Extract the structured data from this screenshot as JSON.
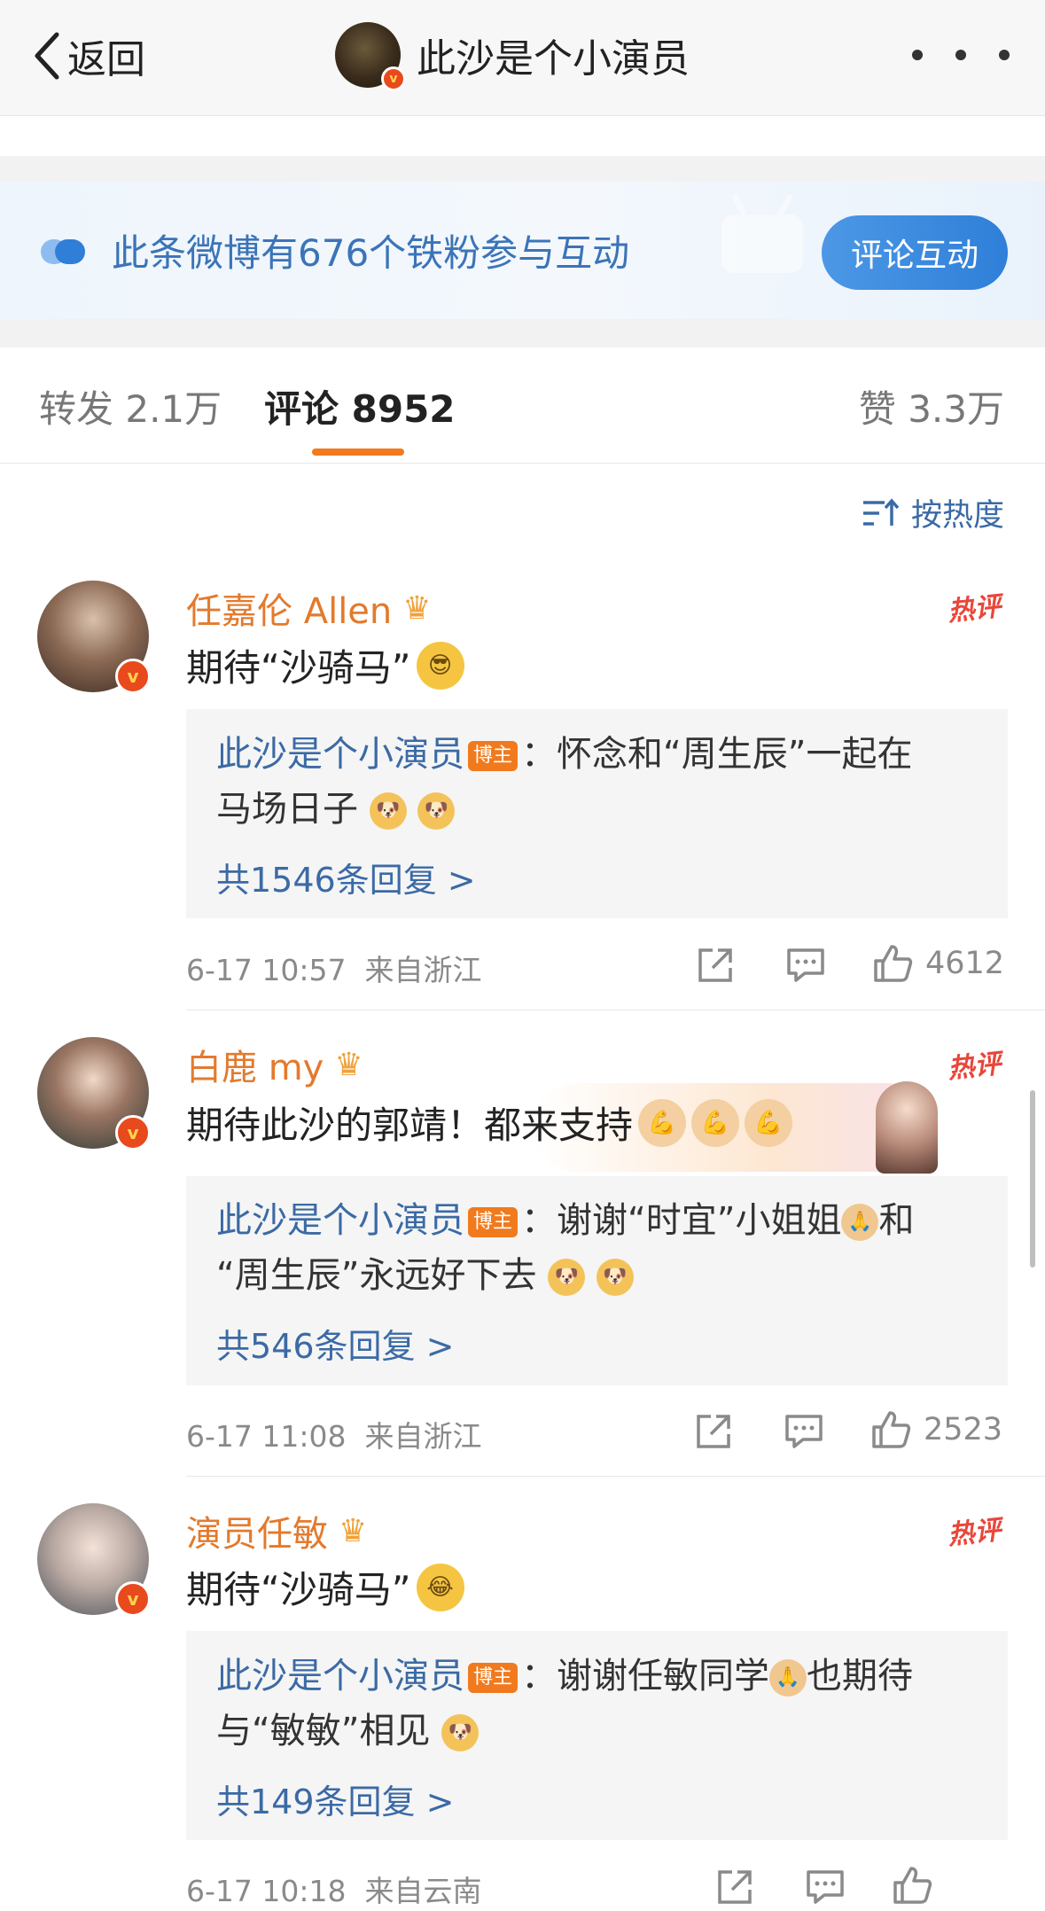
{
  "nav": {
    "back_label": "返回",
    "title": "此沙是个小演员",
    "more_label": "more"
  },
  "banner": {
    "text": "此条微博有676个铁粉参与互动",
    "button": "评论互动"
  },
  "tabs": {
    "repost": "转发 2.1万",
    "comment": "评论 8952",
    "like": "赞 3.3万"
  },
  "sort_label": "按热度",
  "comments": [
    {
      "name": "任嘉伦 Allen",
      "hot_label": "热评",
      "text": "期待“沙骑马”",
      "reply_user": "此沙是个小演员",
      "reply_tag": "博主",
      "reply_line1": "：怀念和“周生辰”一起在",
      "reply_line2": "马场日子",
      "reply_count": "共1546条回复 >",
      "time": "6-17 10:57",
      "location": "来自浙江",
      "likes": "4612"
    },
    {
      "name": "白鹿 my",
      "hot_label": "热评",
      "text": "期待此沙的郭靖！都来支持",
      "reply_user": "此沙是个小演员",
      "reply_tag": "博主",
      "reply_line1": "：谢谢“时宜”小姐姐",
      "reply_line1b": "和",
      "reply_line2": "“周生辰”永远好下去",
      "reply_count": "共546条回复 >",
      "time": "6-17 11:08",
      "location": "来自浙江",
      "likes": "2523"
    },
    {
      "name": "演员任敏",
      "hot_label": "热评",
      "text": "期待“沙骑马”",
      "reply_user": "此沙是个小演员",
      "reply_tag": "博主",
      "reply_line1": "：谢谢任敏同学",
      "reply_line1b": "也期待",
      "reply_line2": "与“敏敏”相见",
      "reply_count": "共149条回复 >",
      "time": "6-17 10:18",
      "location": "来自云南",
      "likes": ""
    }
  ],
  "colors": {
    "accent_orange": "#f07a1d",
    "link_blue": "#3b6aa5",
    "name_orange": "#e37a2d",
    "hot_red": "#e8473a",
    "button_blue": "#2f7fd9"
  }
}
